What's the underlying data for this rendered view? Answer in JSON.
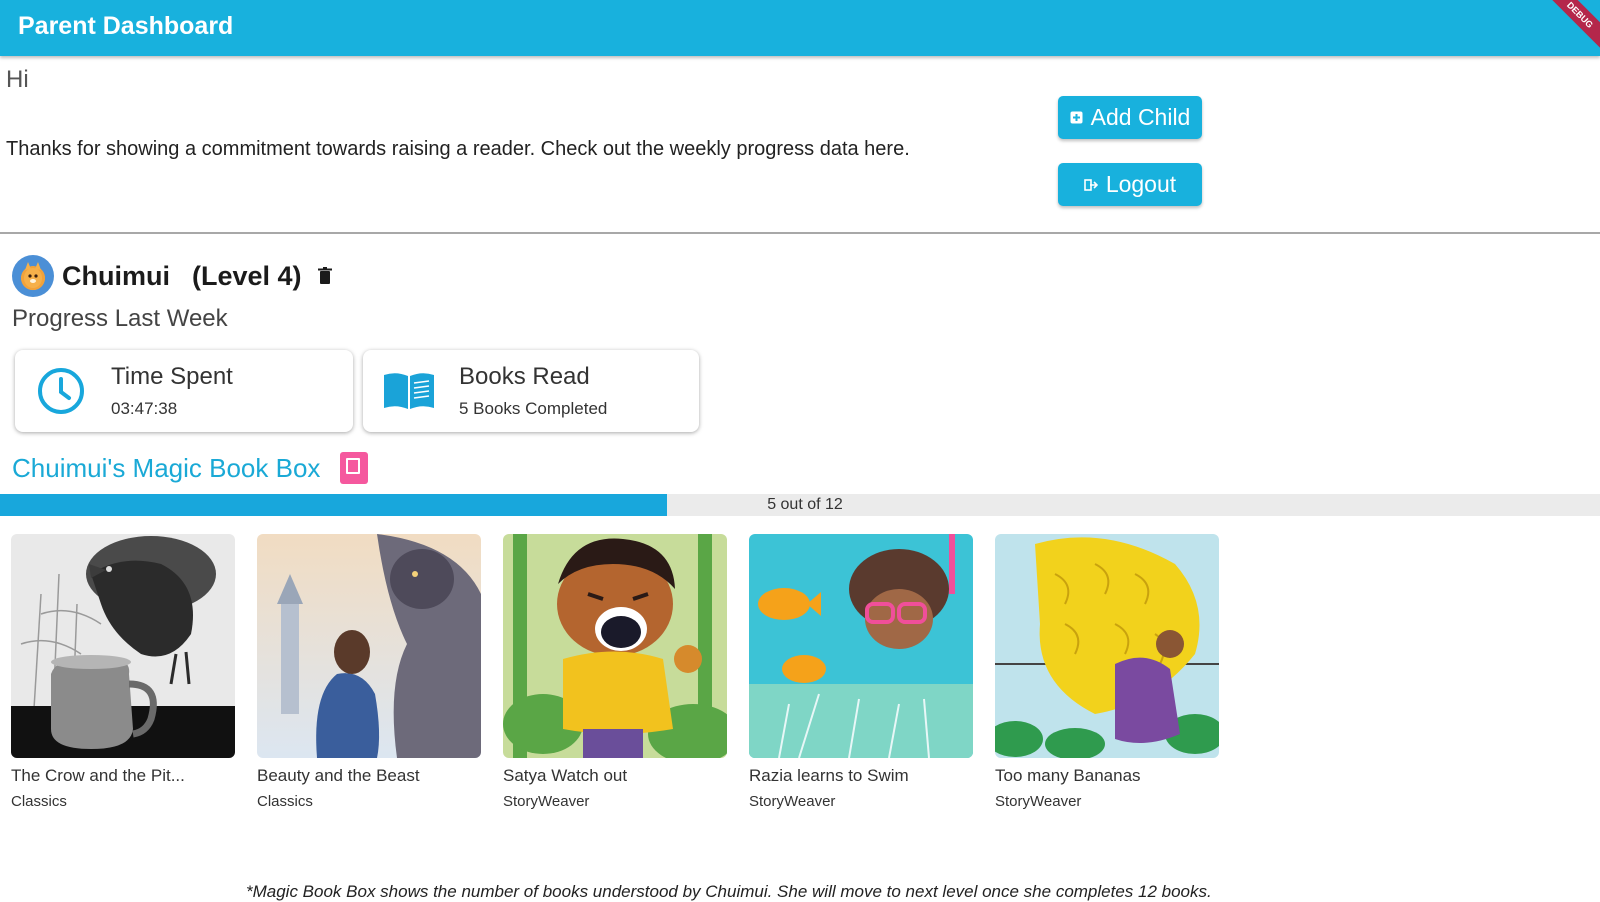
{
  "appbar": {
    "title": "Parent Dashboard",
    "debug_banner": "DEBUG"
  },
  "intro": {
    "greeting": "Hi",
    "message": "Thanks for showing a commitment towards raising a reader. Check out the weekly progress data here."
  },
  "actions": {
    "add_child_label": "Add Child",
    "logout_label": "Logout"
  },
  "child": {
    "name": "Chuimui",
    "level": "(Level 4)",
    "progress_label": "Progress Last Week",
    "stats": {
      "time_title": "Time Spent",
      "time_value": "03:47:38",
      "books_title": "Books Read",
      "books_value": "5 Books Completed"
    }
  },
  "magic_box": {
    "title": "Chuimui's Magic Book Box",
    "progress_text": "5 out of 12",
    "completed": 5,
    "total": 12
  },
  "books": [
    {
      "title": "The Crow and the Pit...",
      "source": "Classics",
      "cover": "crow-pitcher"
    },
    {
      "title": "Beauty and the Beast",
      "source": "Classics",
      "cover": "beauty-beast"
    },
    {
      "title": "Satya Watch out",
      "source": "StoryWeaver",
      "cover": "satya"
    },
    {
      "title": "Razia learns to Swim",
      "source": "StoryWeaver",
      "cover": "razia"
    },
    {
      "title": "Too many Bananas",
      "source": "StoryWeaver",
      "cover": "bananas"
    }
  ],
  "footnote": "*Magic Book Box shows the number of books understood by Chuimui. She will move to next level once she completes 12 books.",
  "colors": {
    "primary": "#18b1dd",
    "accent_pink": "#f5589e",
    "track": "#ebebeb"
  }
}
